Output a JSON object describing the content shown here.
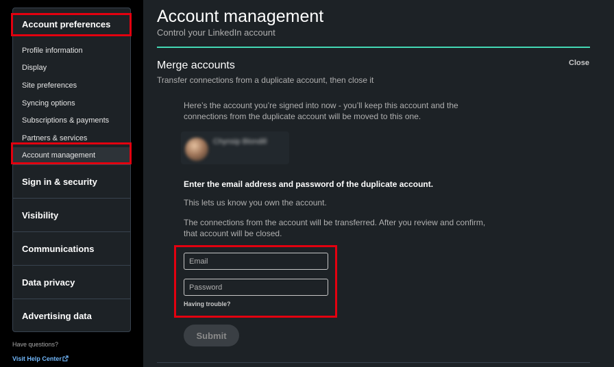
{
  "sidebar": {
    "header": "Account preferences",
    "sub_items": [
      {
        "label": "Profile information"
      },
      {
        "label": "Display"
      },
      {
        "label": "Site preferences"
      },
      {
        "label": "Syncing options"
      },
      {
        "label": "Subscriptions & payments"
      },
      {
        "label": "Partners & services"
      },
      {
        "label": "Account management"
      }
    ],
    "sections": [
      {
        "label": "Sign in & security"
      },
      {
        "label": "Visibility"
      },
      {
        "label": "Communications"
      },
      {
        "label": "Data privacy"
      },
      {
        "label": "Advertising data"
      }
    ],
    "help_question": "Have questions?",
    "help_link": "Visit Help Center"
  },
  "main": {
    "title": "Account management",
    "subtitle": "Control your LinkedIn account",
    "section_title": "Merge accounts",
    "close_label": "Close",
    "section_subtitle": "Transfer connections from a duplicate account, then close it",
    "intro": "Here’s the account you’re signed into now - you’ll keep this account and the connections from the duplicate account will be moved to this one.",
    "account_name": "Chynsip Blondill",
    "enter_heading": "Enter the email address and password of the duplicate account.",
    "ownership_note": "This lets us know you own the account.",
    "transfer_note": "The connections from the account will be transferred. After you review and confirm, that account will be closed.",
    "email_placeholder": "Email",
    "password_placeholder": "Password",
    "trouble_link": "Having trouble?",
    "submit_label": "Submit"
  },
  "colors": {
    "accent_line": "#44d9b5",
    "highlight": "#e3000f",
    "link": "#71b7fb"
  }
}
